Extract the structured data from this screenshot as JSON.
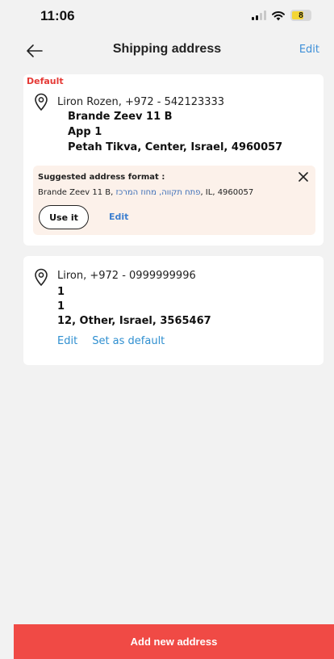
{
  "status_bar": {
    "time": "11:06",
    "battery_level": "8"
  },
  "header": {
    "title": "Shipping address",
    "edit_label": "Edit"
  },
  "addresses": [
    {
      "default_label": "Default",
      "name_line": "Liron Rozen, +972 - 542123333",
      "line1": "Brande Zeev 11 B",
      "line2": "App 1",
      "line3": "Petah Tikva, Center, Israel, 4960057",
      "suggestion": {
        "title": "Suggested address format :",
        "text_prefix": "Brande Zeev 11 B, ",
        "text_hebrew": "פתח תקווה, מחוז המרכז",
        "text_suffix": ", IL, 4960057",
        "use_label": "Use it",
        "edit_label": "Edit"
      }
    },
    {
      "name_line": "Liron, +972 - 0999999996",
      "line1": "1",
      "line2": "1",
      "line3": "12, Other, Israel, 3565467",
      "edit_label": "Edit",
      "default_action_label": "Set as default"
    }
  ],
  "footer": {
    "add_label": "Add new address"
  },
  "colors": {
    "accent_red": "#f04a45",
    "link_blue": "#2f8fd0",
    "default_red": "#e53935",
    "suggest_bg": "#fcf1ea"
  },
  "icons": [
    "back-arrow-icon",
    "location-pin-icon",
    "close-icon",
    "wifi-icon",
    "signal-icon",
    "battery-icon"
  ]
}
